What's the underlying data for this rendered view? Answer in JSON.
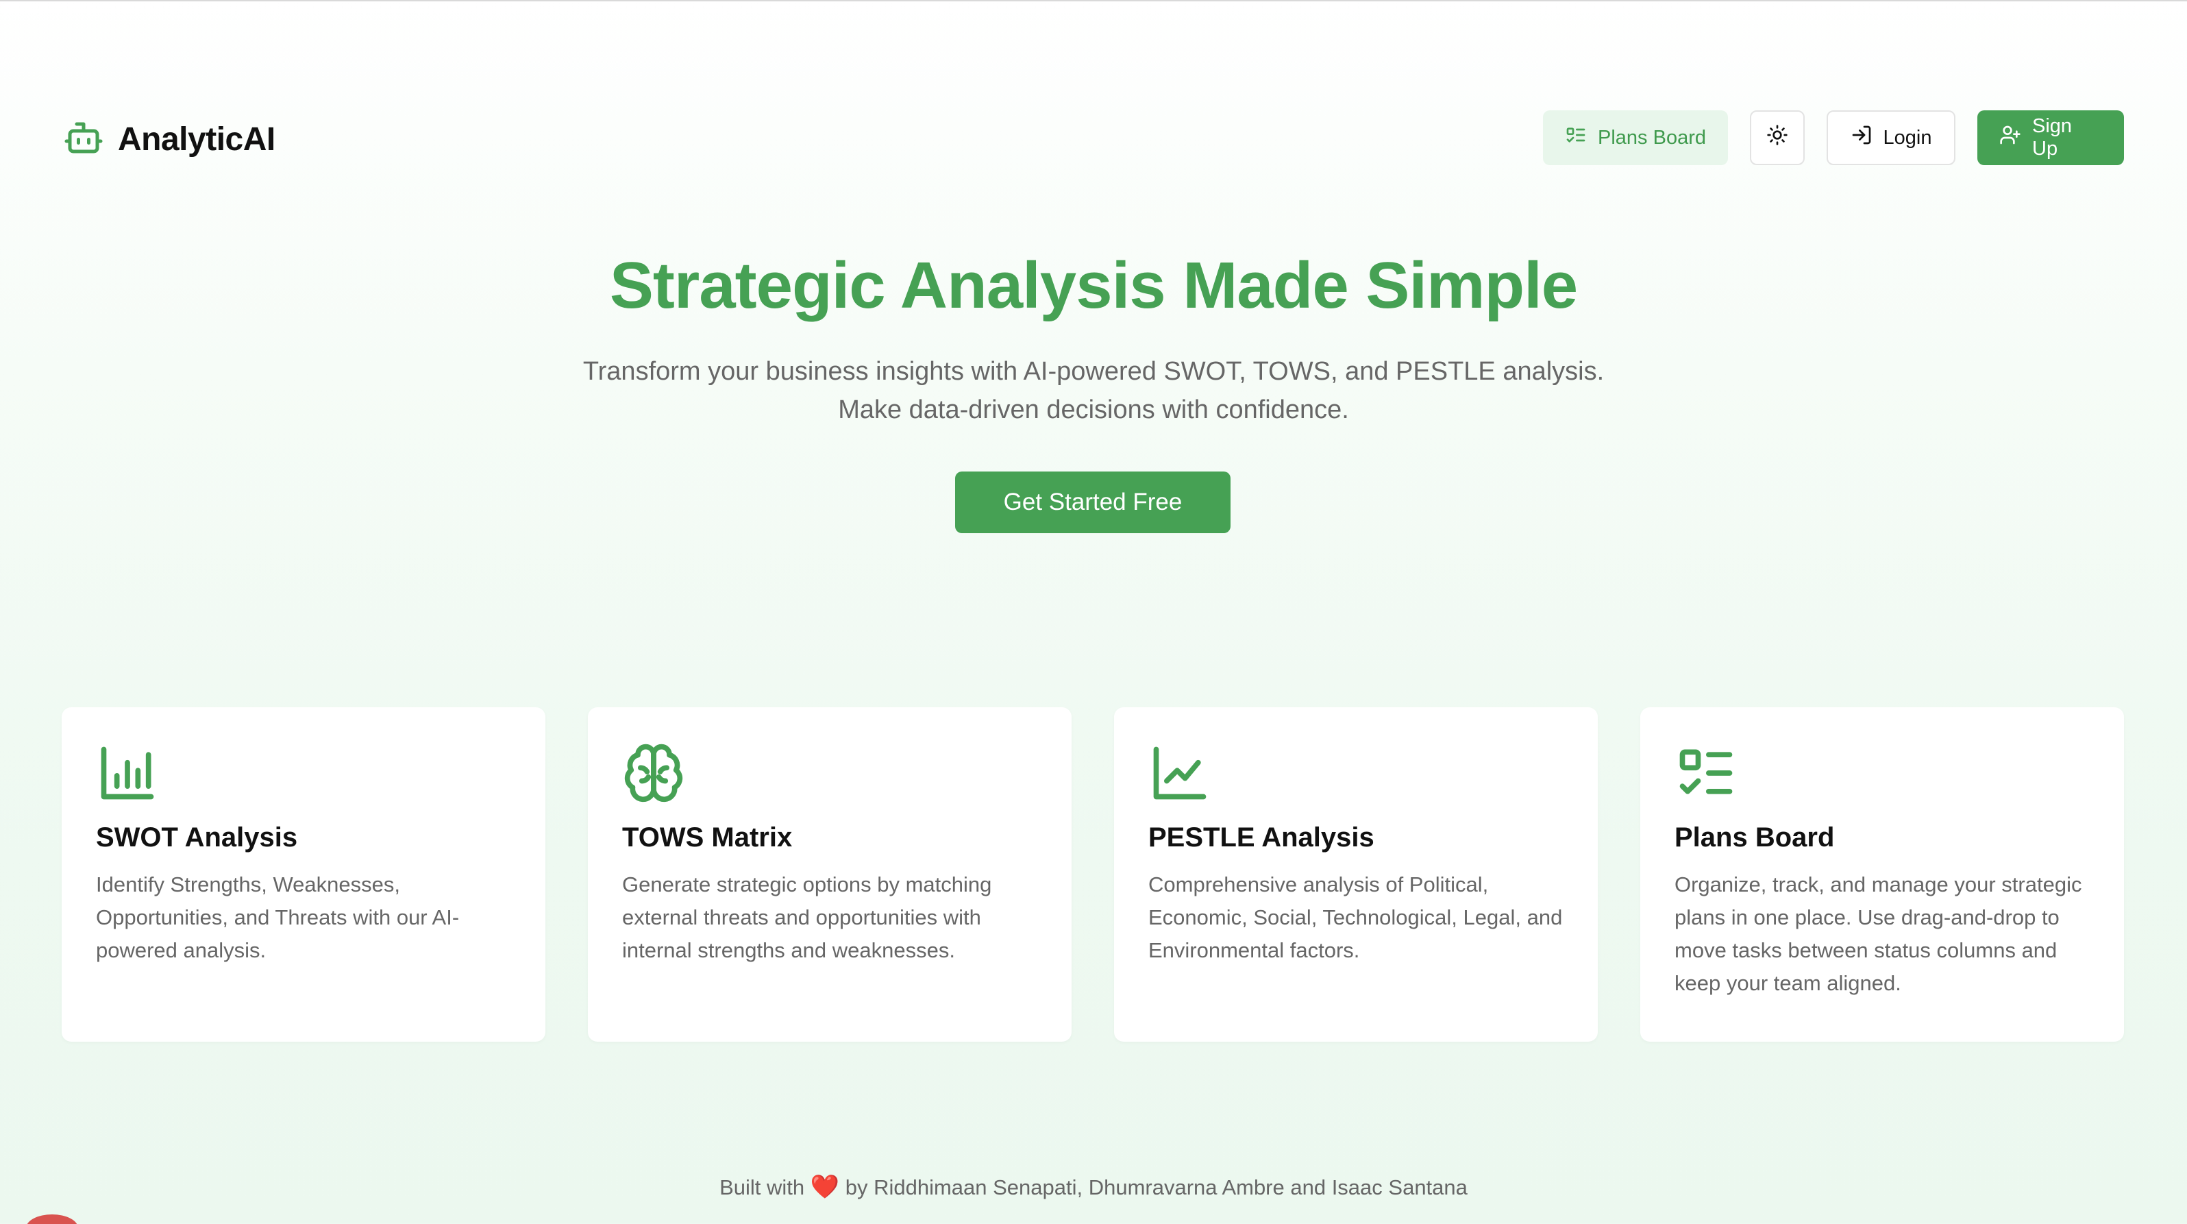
{
  "brand": {
    "name": "AnalyticAI",
    "icon": "robot-icon"
  },
  "nav": {
    "plans_label": "Plans Board",
    "login_label": "Login",
    "signup_label": "Sign Up"
  },
  "hero": {
    "title": "Strategic Analysis Made Simple",
    "subtitle_line1": "Transform your business insights with AI-powered SWOT, TOWS, and PESTLE analysis.",
    "subtitle_line2": "Make data-driven decisions with confidence.",
    "cta_label": "Get Started Free"
  },
  "features": [
    {
      "icon": "bar-chart-icon",
      "title": "SWOT Analysis",
      "desc": "Identify Strengths, Weaknesses, Opportunities, and Threats with our AI-powered analysis."
    },
    {
      "icon": "brain-icon",
      "title": "TOWS Matrix",
      "desc": "Generate strategic options by matching external threats and opportunities with internal strengths and weaknesses."
    },
    {
      "icon": "line-chart-icon",
      "title": "PESTLE Analysis",
      "desc": "Comprehensive analysis of Political, Economic, Social, Technological, Legal, and Environmental factors."
    },
    {
      "icon": "list-check-icon",
      "title": "Plans Board",
      "desc": "Organize, track, and manage your strategic plans in one place. Use drag-and-drop to move tasks between status columns and keep your team aligned."
    }
  ],
  "footer": {
    "prefix": "Built with",
    "heart": "❤️",
    "suffix": "by Riddhimaan Senapati, Dhumravarna Ambre and Isaac Santana"
  },
  "colors": {
    "accent": "#46a154",
    "accent_light": "#e8f6eb",
    "muted_text": "#666666"
  }
}
